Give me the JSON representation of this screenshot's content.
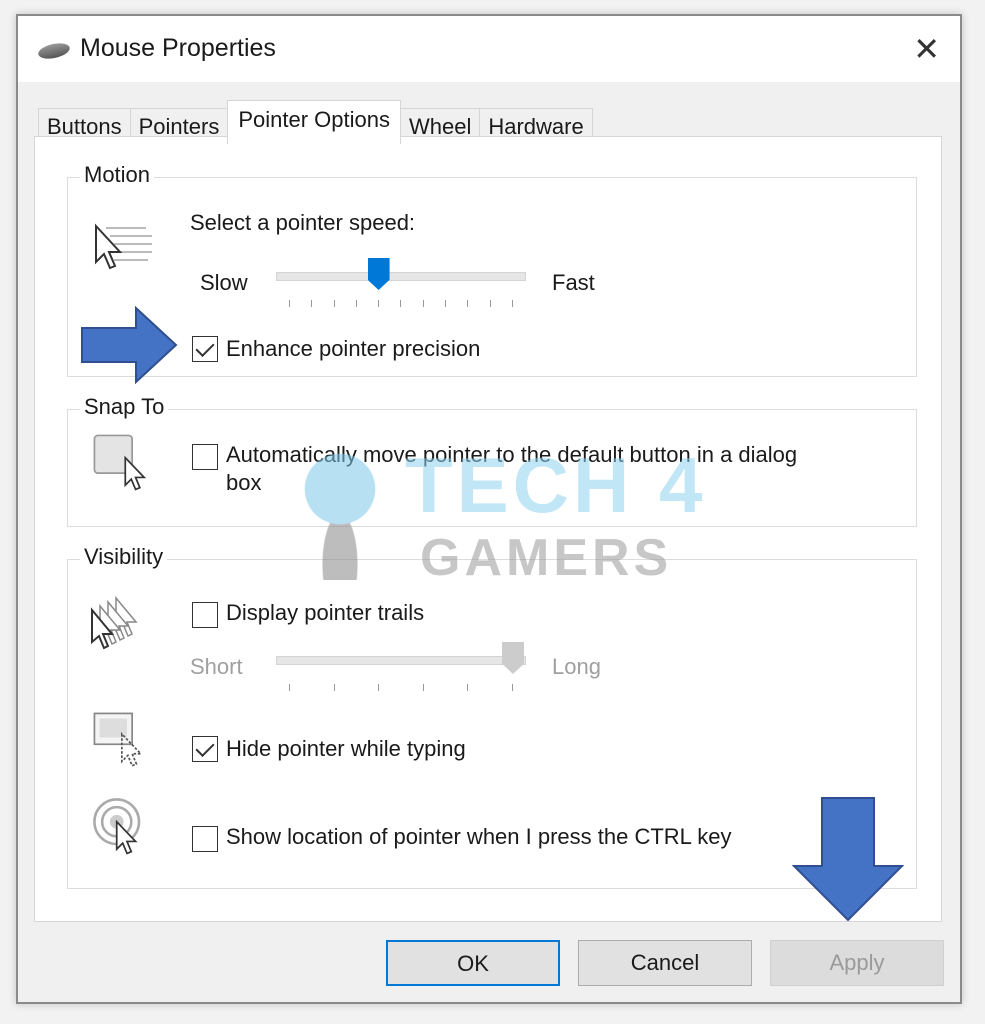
{
  "window": {
    "title": "Mouse Properties",
    "close_icon": "close-icon"
  },
  "tabs": [
    {
      "label": "Buttons"
    },
    {
      "label": "Pointers"
    },
    {
      "label": "Pointer Options",
      "active": true
    },
    {
      "label": "Wheel"
    },
    {
      "label": "Hardware"
    }
  ],
  "motion": {
    "label": "Motion",
    "speed_label": "Select a pointer speed:",
    "slow": "Slow",
    "fast": "Fast",
    "speed_value": 5,
    "speed_steps": 11,
    "enhance_label": "Enhance pointer precision",
    "enhance_checked": true
  },
  "snap": {
    "label": "Snap To",
    "auto_label_line1": "Automatically move pointer to the default button in a dialog",
    "auto_label_line2": "box",
    "checked": false
  },
  "visibility": {
    "label": "Visibility",
    "trails_label": "Display pointer trails",
    "trails_checked": false,
    "short": "Short",
    "long": "Long",
    "trails_value": 1.0,
    "trails_enabled": false,
    "hide_label": "Hide pointer while typing",
    "hide_checked": true,
    "ctrl_label": "Show location of pointer when I press the CTRL key",
    "ctrl_checked": false
  },
  "buttons": {
    "ok": "OK",
    "cancel": "Cancel",
    "apply": "Apply"
  },
  "annotations": {
    "arrow_color": "#4472c4"
  },
  "watermark": {
    "line1": "TECH 4",
    "line2": "GAMERS"
  },
  "colors": {
    "accent": "#0078d7"
  }
}
